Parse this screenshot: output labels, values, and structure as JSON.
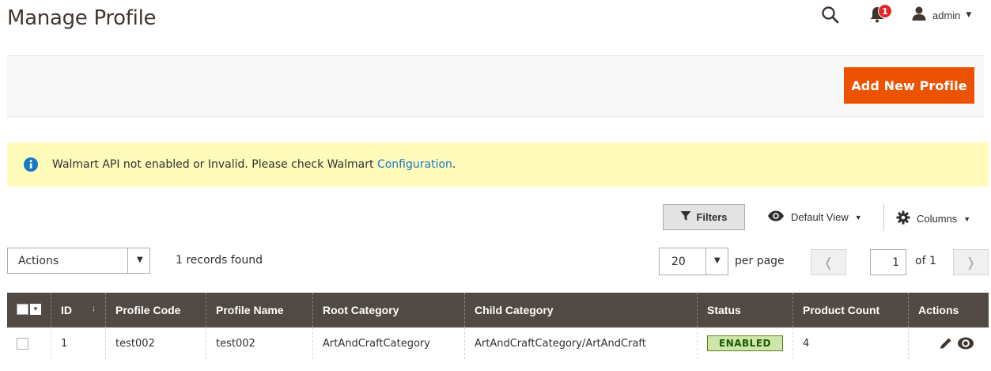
{
  "page": {
    "title": "Manage Profile"
  },
  "header": {
    "notification_count": "1",
    "username": "admin"
  },
  "toolbar": {
    "add_button_label": "Add New Profile"
  },
  "message": {
    "text": "Walmart API not enabled or Invalid. Please check Walmart ",
    "link_text": "Configuration",
    "trailing": "."
  },
  "grid_controls": {
    "filters_label": "Filters",
    "view_label": "Default View",
    "columns_label": "Columns"
  },
  "mass_actions": {
    "label": "Actions"
  },
  "records_text": "1 records found",
  "pagination": {
    "per_page_value": "20",
    "per_page_label": "per page",
    "current_page": "1",
    "of_label": "of 1"
  },
  "table": {
    "headers": {
      "id": "ID",
      "profile_code": "Profile Code",
      "profile_name": "Profile Name",
      "root_category": "Root Category",
      "child_category": "Child Category",
      "status": "Status",
      "product_count": "Product Count",
      "actions": "Actions"
    },
    "rows": [
      {
        "id": "1",
        "profile_code": "test002",
        "profile_name": "test002",
        "root_category": "ArtAndCraftCategory",
        "child_category": "ArtAndCraftCategory/ArtAndCraft",
        "status": "ENABLED",
        "product_count": "4"
      }
    ]
  },
  "icons": {
    "search": "search-icon",
    "notifications": "bell-icon",
    "user": "user-icon",
    "info": "info-icon",
    "filter": "filter-icon",
    "view": "eye-icon",
    "columns": "gear-icon",
    "edit": "pencil-icon",
    "preview": "eye-icon"
  },
  "colors": {
    "primary_button": "#eb5202",
    "grid_header": "#514943",
    "message_bg": "#fffbbb",
    "link": "#1979c3",
    "enabled_badge_bg": "#d0e5a9"
  }
}
